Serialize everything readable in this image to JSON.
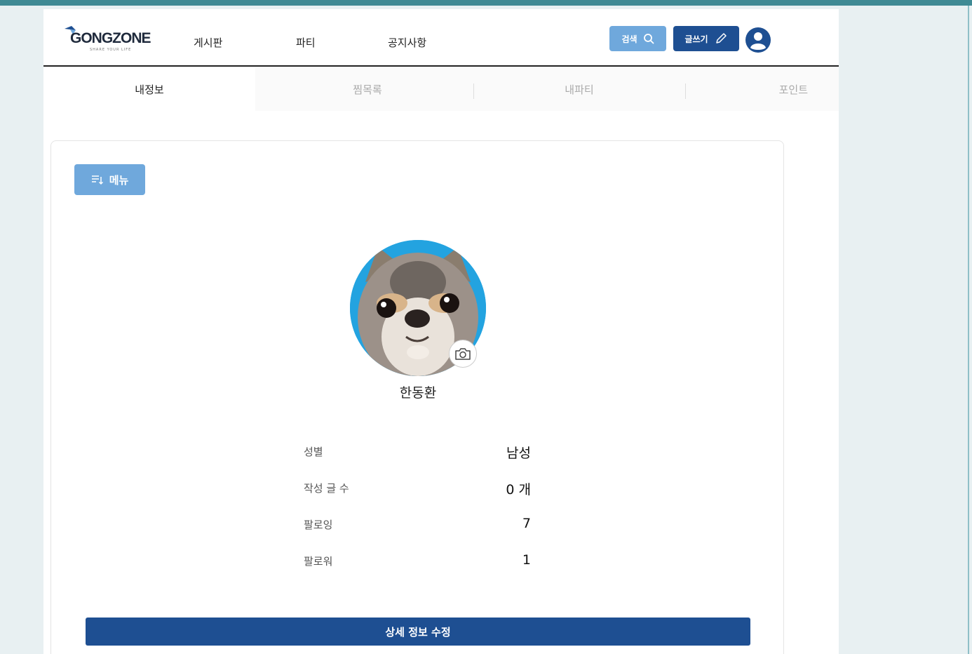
{
  "brand": {
    "name": "GONGZONE",
    "tagline": "SHARE YOUR LIFE",
    "colors": {
      "primary": "#1e4f92",
      "accent": "#6fa8dc",
      "frame": "#3f8a94"
    }
  },
  "nav": {
    "items": [
      {
        "label": "게시판"
      },
      {
        "label": "파티"
      },
      {
        "label": "공지사항"
      }
    ],
    "search_label": "검색",
    "write_label": "글쓰기",
    "icons": {
      "search": "search-icon",
      "write": "pencil-icon",
      "user": "user-circle-icon"
    }
  },
  "tabs": [
    {
      "label": "내정보",
      "active": true
    },
    {
      "label": "찜목록",
      "active": false
    },
    {
      "label": "내파티",
      "active": false
    },
    {
      "label": "포인트",
      "active": false
    }
  ],
  "profile": {
    "menu_label": "메뉴",
    "menu_icon": "sort-list-icon",
    "avatar_icon": "dog-avatar",
    "camera_icon": "camera-icon",
    "name": "한동환",
    "fields": [
      {
        "label": "성별",
        "value": "남성"
      },
      {
        "label": "작성 글 수",
        "value": "0 개"
      },
      {
        "label": "팔로잉",
        "value": "7"
      },
      {
        "label": "팔로워",
        "value": "1"
      }
    ],
    "edit_label": "상세 정보 수정"
  }
}
